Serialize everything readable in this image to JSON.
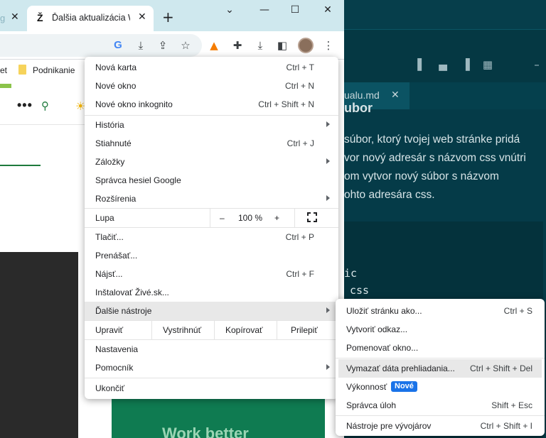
{
  "browser": {
    "tabs": [
      {
        "favicon": "g",
        "title": ""
      },
      {
        "favicon": "Ž",
        "title": "Ďalšia aktualizácia W"
      }
    ],
    "new_tab_symbol": "+",
    "bookmarks": [
      "et",
      "Podnikanie"
    ]
  },
  "editor": {
    "tab_name": "ualu.md",
    "heading_fragment": "ubor",
    "text_lines": [
      "súbor, ktorý tvojej web stránke pridá",
      "vor nový adresár s názvom css vnútri",
      "om vytvor nový súbor s názvom",
      "ohto adresára css."
    ],
    "code_lines": [
      "ic",
      "css"
    ]
  },
  "page": {
    "promo_text": "Work better"
  },
  "menu": {
    "items": [
      {
        "label": "Nová karta",
        "shortcut": "Ctrl + T"
      },
      {
        "label": "Nové okno",
        "shortcut": "Ctrl + N"
      },
      {
        "label": "Nové okno inkognito",
        "shortcut": "Ctrl + Shift + N"
      },
      {
        "label": "História",
        "shortcut": ""
      },
      {
        "label": "Stiahnuté",
        "shortcut": "Ctrl + J"
      },
      {
        "label": "Záložky",
        "shortcut": ""
      },
      {
        "label": "Správca hesiel Google",
        "shortcut": ""
      },
      {
        "label": "Rozšírenia",
        "shortcut": ""
      },
      {
        "label": "Tlačiť...",
        "shortcut": "Ctrl + P"
      },
      {
        "label": "Prenášať...",
        "shortcut": ""
      },
      {
        "label": "Nájsť...",
        "shortcut": "Ctrl + F"
      },
      {
        "label": "Inštalovať Živé.sk...",
        "shortcut": ""
      },
      {
        "label": "Ďalšie nástroje",
        "shortcut": ""
      },
      {
        "label": "Nastavenia",
        "shortcut": ""
      },
      {
        "label": "Pomocník",
        "shortcut": ""
      },
      {
        "label": "Ukončiť",
        "shortcut": ""
      }
    ],
    "zoom": {
      "label": "Lupa",
      "minus": "–",
      "value": "100 %",
      "plus": "+"
    },
    "edit": {
      "label": "Upraviť",
      "cut": "Vystrihnúť",
      "copy": "Kopírovať",
      "paste": "Prilepiť"
    }
  },
  "submenu": {
    "items": [
      {
        "label": "Uložiť stránku ako...",
        "shortcut": "Ctrl + S"
      },
      {
        "label": "Vytvoriť odkaz...",
        "shortcut": ""
      },
      {
        "label": "Pomenovať okno...",
        "shortcut": ""
      },
      {
        "label": "Vymazať dáta prehliadania...",
        "shortcut": "Ctrl + Shift + Del"
      },
      {
        "label": "Výkonnosť",
        "shortcut": "",
        "badge": "Nové"
      },
      {
        "label": "Správca úloh",
        "shortcut": "Shift + Esc"
      },
      {
        "label": "Nástroje pre vývojárov",
        "shortcut": "Ctrl + Shift + I"
      }
    ]
  },
  "colors": {
    "editor_bg": "#053b48",
    "tabstrip_bg": "#cfe8ee",
    "badge_blue": "#1a73e8",
    "site_green": "#1e7a3c"
  }
}
